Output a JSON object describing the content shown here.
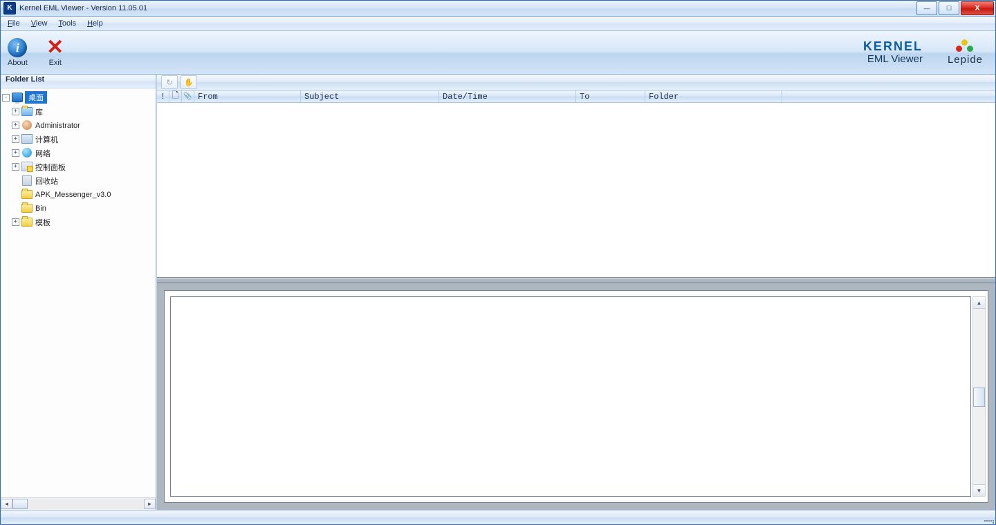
{
  "window": {
    "title": "Kernel EML Viewer - Version 11.05.01"
  },
  "menu": {
    "file": "File",
    "view": "View",
    "tools": "Tools",
    "help": "Help"
  },
  "toolbar": {
    "about": "About",
    "exit": "Exit"
  },
  "brand": {
    "kernel_line1": "KERNEL",
    "kernel_line2": "EML Viewer",
    "lepide": "Lepide"
  },
  "sidebar": {
    "title": "Folder List",
    "root": "桌面",
    "items": [
      {
        "label": "库",
        "exp": "+"
      },
      {
        "label": "Administrator",
        "exp": "+"
      },
      {
        "label": "计算机",
        "exp": "+"
      },
      {
        "label": "网络",
        "exp": "+"
      },
      {
        "label": "控制面板",
        "exp": "+"
      },
      {
        "label": "回收站",
        "exp": ""
      },
      {
        "label": "APK_Messenger_v3.0",
        "exp": ""
      },
      {
        "label": "Bin",
        "exp": ""
      },
      {
        "label": "模板",
        "exp": "+"
      }
    ]
  },
  "icons": {
    "exclaim": "!",
    "page": "🗋",
    "attach": "📎"
  },
  "columns": {
    "from": "From",
    "subject": "Subject",
    "datetime": "Date/Time",
    "to": "To",
    "folder": "Folder"
  }
}
